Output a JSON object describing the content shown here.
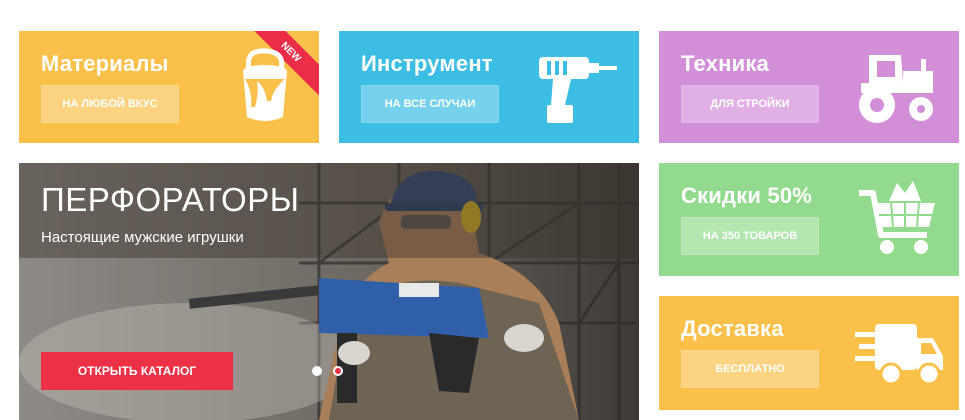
{
  "tiles": [
    {
      "title": "Материалы",
      "button": "НА ЛЮБОЙ ВКУС",
      "badge": "NEW",
      "icon": "paint-bucket-icon",
      "color": "#fbc04a"
    },
    {
      "title": "Инструмент",
      "button": "НА ВСЕ СЛУЧАИ",
      "icon": "drill-icon",
      "color": "#3bbde4"
    },
    {
      "title": "Техника",
      "button": "ДЛЯ СТРОЙКИ",
      "icon": "tractor-icon",
      "color": "#d38ed8"
    },
    {
      "title": "Скидки 50%",
      "button": "НА 350 ТОВАРОВ",
      "icon": "shopping-cart-icon",
      "color": "#92db8e"
    },
    {
      "title": "Доставка",
      "button": "БЕСПЛАТНО",
      "icon": "delivery-truck-icon",
      "color": "#fbc04a"
    }
  ],
  "banner": {
    "title": "ПЕРФОРАТОРЫ",
    "subtitle": "Настоящие мужские игрушки",
    "cta": "ОТКРЫТЬ КАТАЛОГ",
    "slider_dots": 2,
    "active_dot": 1,
    "cta_color": "#ec3045"
  }
}
